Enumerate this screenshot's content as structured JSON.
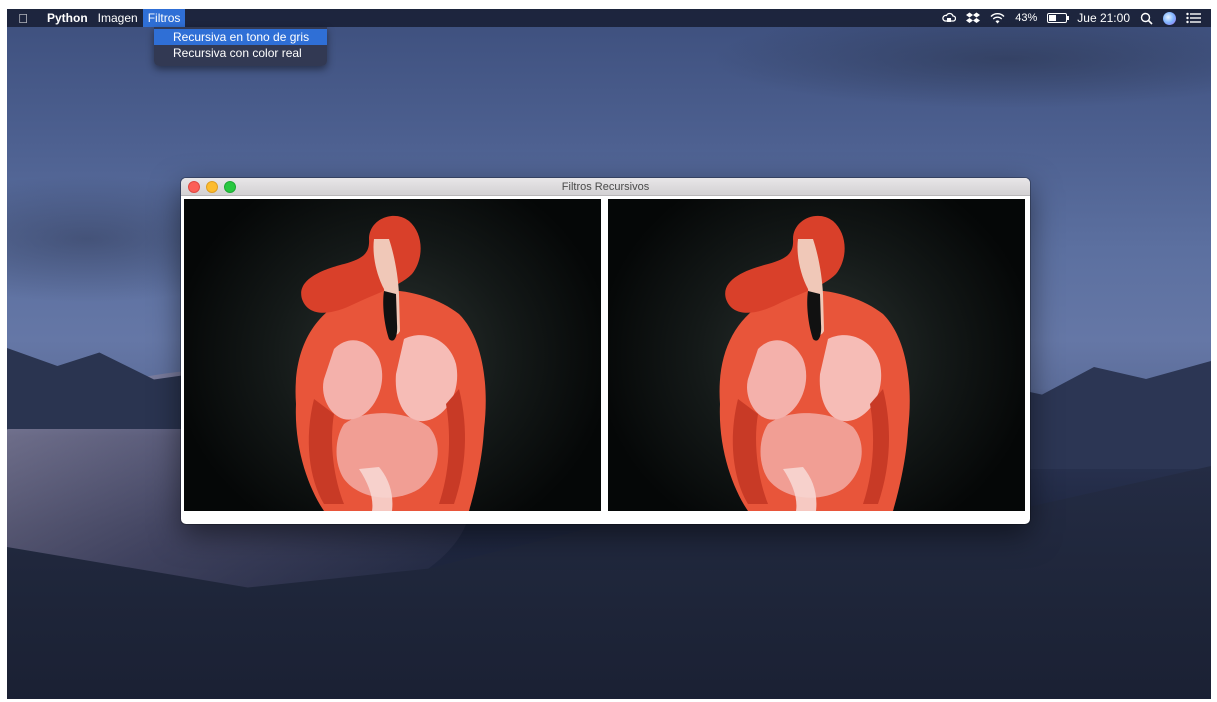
{
  "menubar": {
    "app_name": "Python",
    "menus": [
      "Imagen",
      "Filtros"
    ],
    "active_menu": "Filtros",
    "status": {
      "battery_percent": "43%",
      "battery_level": 0.43,
      "datetime": "Jue 21:00"
    },
    "icons": [
      "apple-icon",
      "cloud-status-icon",
      "dropbox-icon",
      "wifi-icon",
      "battery-icon",
      "spotlight-search-icon",
      "siri-icon",
      "notification-center-icon"
    ]
  },
  "dropdown": {
    "items": [
      "Recursiva en tono de gris",
      "Recursiva con color real"
    ],
    "highlighted_index": 0
  },
  "window": {
    "title": "Filtros Recursivos",
    "panels": [
      "original-flamingo-image",
      "filtered-flamingo-image"
    ]
  },
  "colors": {
    "menu_highlight": "#2f6fd6",
    "flamingo": "#e8553a",
    "close": "#fc5f57",
    "minimize": "#fdbc2e",
    "zoom": "#28c840"
  }
}
